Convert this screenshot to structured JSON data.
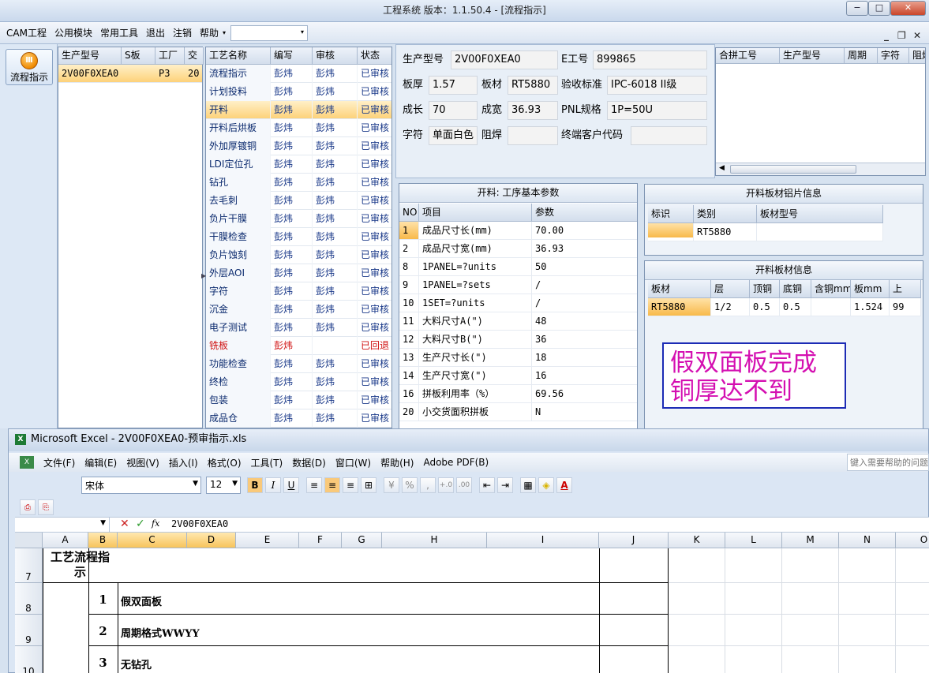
{
  "window": {
    "title": "工程系统  版本：1.1.50.4 - [流程指示]",
    "btn_min": "−",
    "btn_max": "□",
    "btn_close": "✕"
  },
  "menu": {
    "items": [
      "CAM工程",
      "公用模块",
      "常用工具",
      "退出",
      "注销",
      "帮助"
    ],
    "dropdown_arrow": "▾",
    "mdi_min": "_",
    "mdi_restore": "❐",
    "mdi_close": "✕"
  },
  "leftnav": {
    "flow_button": "流程指示",
    "icon_glyph": "Ⅲ"
  },
  "orders": {
    "headers": [
      "生产型号",
      "S板",
      "工厂",
      "交"
    ],
    "rows": [
      {
        "model": "2V00F0XEA0",
        "s": "",
        "factory": "P3",
        "due": "20"
      }
    ]
  },
  "process": {
    "headers": [
      "工艺名称",
      "编写",
      "审核",
      "状态"
    ],
    "rows": [
      {
        "name": "流程指示",
        "author": "彭炜",
        "reviewer": "彭炜",
        "status": "已审核"
      },
      {
        "name": "计划投料",
        "author": "彭炜",
        "reviewer": "彭炜",
        "status": "已审核"
      },
      {
        "name": "开料",
        "author": "彭炜",
        "reviewer": "彭炜",
        "status": "已审核"
      },
      {
        "name": "开料后烘板",
        "author": "彭炜",
        "reviewer": "彭炜",
        "status": "已审核"
      },
      {
        "name": "外加厚镀铜",
        "author": "彭炜",
        "reviewer": "彭炜",
        "status": "已审核"
      },
      {
        "name": "LDI定位孔",
        "author": "彭炜",
        "reviewer": "彭炜",
        "status": "已审核"
      },
      {
        "name": "钻孔",
        "author": "彭炜",
        "reviewer": "彭炜",
        "status": "已审核"
      },
      {
        "name": "去毛刺",
        "author": "彭炜",
        "reviewer": "彭炜",
        "status": "已审核"
      },
      {
        "name": "负片干膜",
        "author": "彭炜",
        "reviewer": "彭炜",
        "status": "已审核"
      },
      {
        "name": "干膜检查",
        "author": "彭炜",
        "reviewer": "彭炜",
        "status": "已审核"
      },
      {
        "name": "负片蚀刻",
        "author": "彭炜",
        "reviewer": "彭炜",
        "status": "已审核"
      },
      {
        "name": "外层AOI",
        "author": "彭炜",
        "reviewer": "彭炜",
        "status": "已审核"
      },
      {
        "name": "字符",
        "author": "彭炜",
        "reviewer": "彭炜",
        "status": "已审核"
      },
      {
        "name": "沉金",
        "author": "彭炜",
        "reviewer": "彭炜",
        "status": "已审核"
      },
      {
        "name": "电子测试",
        "author": "彭炜",
        "reviewer": "彭炜",
        "status": "已审核"
      },
      {
        "name": "铣板",
        "author": "彭炜",
        "reviewer": "",
        "status": "已回退"
      },
      {
        "name": "功能检查",
        "author": "彭炜",
        "reviewer": "彭炜",
        "status": "已审核"
      },
      {
        "name": "终检",
        "author": "彭炜",
        "reviewer": "彭炜",
        "status": "已审核"
      },
      {
        "name": "包装",
        "author": "彭炜",
        "reviewer": "彭炜",
        "status": "已审核"
      },
      {
        "name": "成品仓",
        "author": "彭炜",
        "reviewer": "彭炜",
        "status": "已审核"
      }
    ]
  },
  "info": {
    "model_label": "生产型号",
    "model": "2V00F0XEA0",
    "e_label": "E工号",
    "e_no": "899865",
    "thick_label": "板厚",
    "thick": "1.57",
    "mat_label": "板材",
    "mat": "RT5880",
    "std_label": "验收标准",
    "std": "IPC-6018 II级",
    "len_label": "成长",
    "len": "70",
    "wid_label": "成宽",
    "wid": "36.93",
    "pnl_label": "PNL规格",
    "pnl": "1P=50U",
    "char_label": "字符",
    "char": "单面白色",
    "mask_label": "阻焊",
    "mask": "",
    "cust_label": "终端客户代码",
    "cust": ""
  },
  "combine": {
    "headers": [
      "合拼工号",
      "生产型号",
      "周期",
      "字符",
      "阻焊"
    ],
    "scroll_left": "◀"
  },
  "params": {
    "title": "开料: 工序基本参数",
    "headers": [
      "NO",
      "项目",
      "参数"
    ],
    "rows": [
      {
        "no": "1",
        "item": "成品尺寸长(mm)",
        "value": "70.00"
      },
      {
        "no": "2",
        "item": "成品尺寸宽(mm)",
        "value": "36.93"
      },
      {
        "no": "8",
        "item": "1PANEL=?units",
        "value": "50"
      },
      {
        "no": "9",
        "item": "1PANEL=?sets",
        "value": "/"
      },
      {
        "no": "10",
        "item": "1SET=?units",
        "value": "/"
      },
      {
        "no": "11",
        "item": "大料尺寸A(\")",
        "value": "48"
      },
      {
        "no": "12",
        "item": "大料尺寸B(\")",
        "value": "36"
      },
      {
        "no": "13",
        "item": "生产尺寸长(\")",
        "value": "18"
      },
      {
        "no": "14",
        "item": "生产尺寸宽(\")",
        "value": "16"
      },
      {
        "no": "16",
        "item": "拼板利用率（%）",
        "value": "69.56"
      },
      {
        "no": "20",
        "item": "小交货面积拼板",
        "value": "N"
      }
    ]
  },
  "alu": {
    "title": "开料板材铝片信息",
    "headers": [
      "标识",
      "类别",
      "板材型号"
    ],
    "row": {
      "id": "",
      "cat": "RT5880",
      "model": ""
    }
  },
  "mat": {
    "title": "开料板材信息",
    "headers": [
      "板材",
      "层",
      "顶铜",
      "底铜",
      "含铜mm",
      "板mm",
      "上"
    ],
    "row": [
      "RT5880",
      "1/2",
      "0.5",
      "0.5",
      "",
      "1.524",
      "99"
    ]
  },
  "note": {
    "line1": "假双面板完成",
    "line2": "铜厚达不到"
  },
  "excel": {
    "title": "Microsoft Excel - 2V00F0XEA0-预审指示.xls",
    "menus": [
      "文件(F)",
      "编辑(E)",
      "视图(V)",
      "插入(I)",
      "格式(O)",
      "工具(T)",
      "数据(D)",
      "窗口(W)",
      "帮助(H)",
      "Adobe PDF(B)"
    ],
    "help_placeholder": "键入需要帮助的问题",
    "font": "宋体",
    "size": "12",
    "bold": "B",
    "italic": "I",
    "underline": "U",
    "formula": "2V00F0XEA0",
    "fx": "fx",
    "cancel": "✕",
    "enter": "✓",
    "cols": [
      "A",
      "B",
      "C",
      "D",
      "E",
      "F",
      "G",
      "H",
      "I",
      "J",
      "K",
      "L",
      "M",
      "N",
      "O"
    ],
    "rows": [
      "7",
      "8",
      "9",
      "10"
    ],
    "a7": "工艺流程指示",
    "items": [
      {
        "no": "1",
        "text": "假双面板"
      },
      {
        "no": "2",
        "text": "周期格式WWYY"
      },
      {
        "no": "3",
        "text": "无钻孔"
      }
    ]
  }
}
